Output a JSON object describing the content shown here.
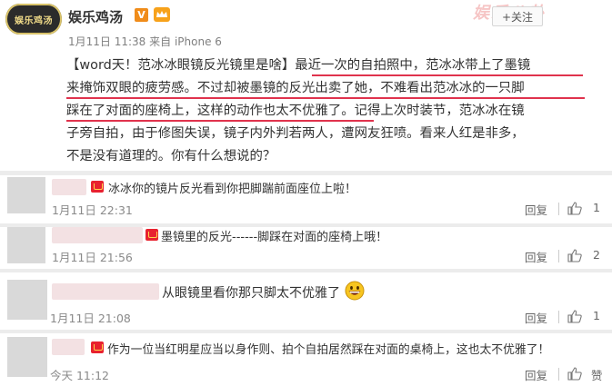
{
  "post": {
    "account_logo_text": "娱乐鸡汤",
    "account_name": "娱乐鸡汤",
    "verified_mark": "V",
    "follow_label": "+关注",
    "watermark_text": "娱乐八卦",
    "time": "1月11日 11:38",
    "source": "来自 iPhone 6",
    "content_lines": [
      "【word天！范冰冰眼镜反光镜里是啥】最近一次的自拍照中，范冰冰带上了墨镜",
      "来掩饰双眼的疲劳感。不过却被墨镜的反光出卖了她，不难看出范冰冰的一只脚",
      "踩在了对面的座椅上，这样的动作也太不优雅了。记得上次时装节，范冰冰在镜",
      "子旁自拍，由于修图失误，镜子内外判若两人，遭网友狂喷。看来人红是非多，",
      "不是没有道理的。你有什么想说的？"
    ],
    "accent_color": "#e0334d"
  },
  "comments": [
    {
      "text": "冰冰你的镜片反光看到你把脚踹前面座位上啦！",
      "time": "1月11日 22:31",
      "reply": "回复",
      "likes": "1"
    },
    {
      "text": "墨镜里的反光------脚踩在对面的座椅上哦！",
      "time": "1月11日 21:56",
      "reply": "回复",
      "likes": "2"
    },
    {
      "text": "从眼镜里看你那只脚太不优雅了",
      "time": "1月11日 21:08",
      "reply": "回复",
      "likes": "1"
    },
    {
      "text": "作为一位当红明星应当以身作则、拍个自拍居然踩在对面的桌椅上，这也太不优雅了！",
      "time": "今天 11:12",
      "reply": "回复",
      "likes": "赞"
    }
  ],
  "icons": {
    "like": "thumbs-up-icon",
    "vip": "crown-icon",
    "member_badge": "member-badge-icon",
    "emoji": "grinning-face-icon"
  }
}
